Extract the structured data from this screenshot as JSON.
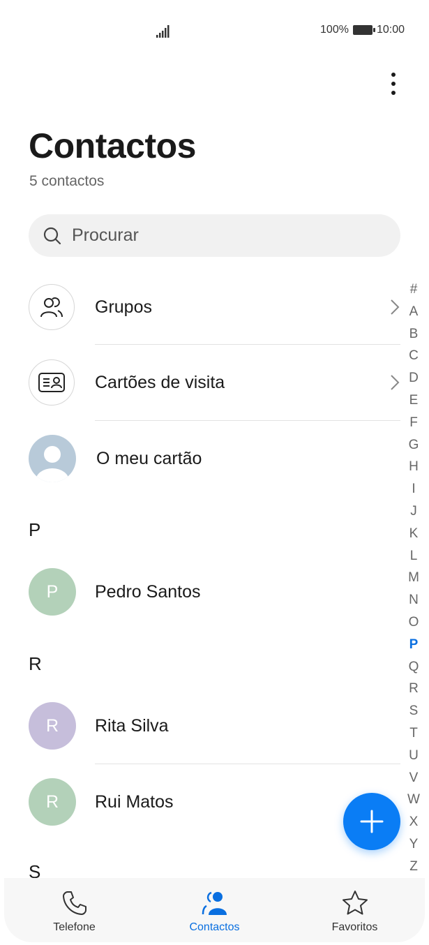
{
  "status_bar": {
    "battery": "100%",
    "time": "10:00"
  },
  "header": {
    "title": "Contactos",
    "subtitle": "5 contactos"
  },
  "search": {
    "placeholder": "Procurar"
  },
  "menu_rows": [
    {
      "label": "Grupos",
      "icon": "groups-icon"
    },
    {
      "label": "Cartões de visita",
      "icon": "business-card-icon"
    },
    {
      "label": "O meu cartão",
      "icon": "profile-avatar-icon"
    }
  ],
  "sections": [
    {
      "letter": "P",
      "contacts": [
        {
          "initial": "P",
          "name": "Pedro Santos",
          "color": "#b3d1b9"
        }
      ]
    },
    {
      "letter": "R",
      "contacts": [
        {
          "initial": "R",
          "name": "Rita Silva",
          "color": "#c6bedb"
        },
        {
          "initial": "R",
          "name": "Rui Matos",
          "color": "#b3d1b9"
        }
      ]
    },
    {
      "letter": "S"
    }
  ],
  "alpha_index": [
    "#",
    "A",
    "B",
    "C",
    "D",
    "E",
    "F",
    "G",
    "H",
    "I",
    "J",
    "K",
    "L",
    "M",
    "N",
    "O",
    "P",
    "Q",
    "R",
    "S",
    "T",
    "U",
    "V",
    "W",
    "X",
    "Y",
    "Z"
  ],
  "alpha_active": "P",
  "bottom_nav": [
    {
      "label": "Telefone",
      "icon": "phone-icon",
      "active": false
    },
    {
      "label": "Contactos",
      "icon": "contacts-icon",
      "active": true
    },
    {
      "label": "Favoritos",
      "icon": "star-icon",
      "active": false
    }
  ],
  "colors": {
    "accent": "#0a7df5",
    "my_card_avatar": "#b8cad9"
  }
}
